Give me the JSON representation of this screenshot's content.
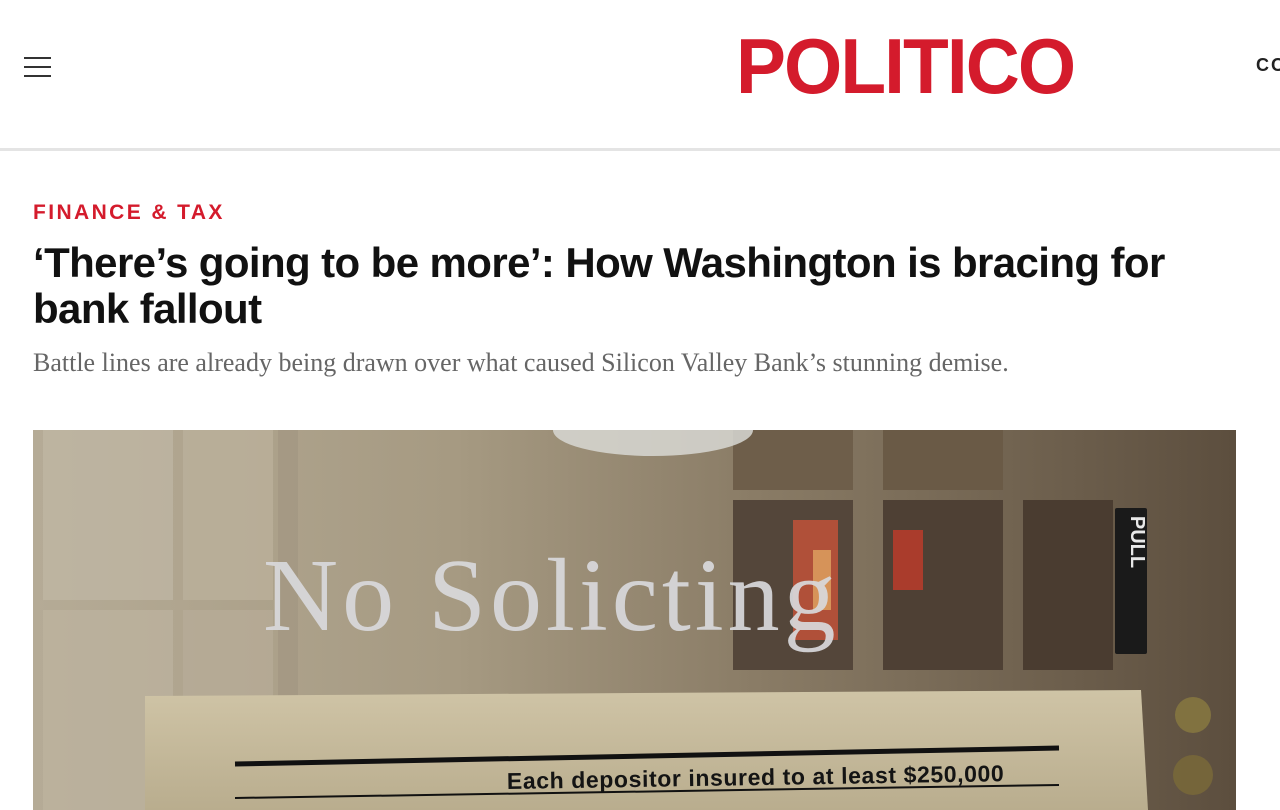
{
  "header": {
    "menu_icon": "hamburger-menu-icon",
    "logo": "POLITICO",
    "right_link": "CO"
  },
  "article": {
    "kicker": "FINANCE & TAX",
    "headline": "‘There’s going to be more’: How Washington is bracing for bank fallout",
    "dek": "Battle lines are already being drawn over what caused Silicon Valley Bank’s stunning demise."
  },
  "hero_image": {
    "door_text": "No Solicting",
    "pull_label": "PULL",
    "plaque_text": "Each depositor insured to at least $250,000"
  },
  "colors": {
    "brand_red": "#d41b2c",
    "dek_gray": "#666666"
  }
}
